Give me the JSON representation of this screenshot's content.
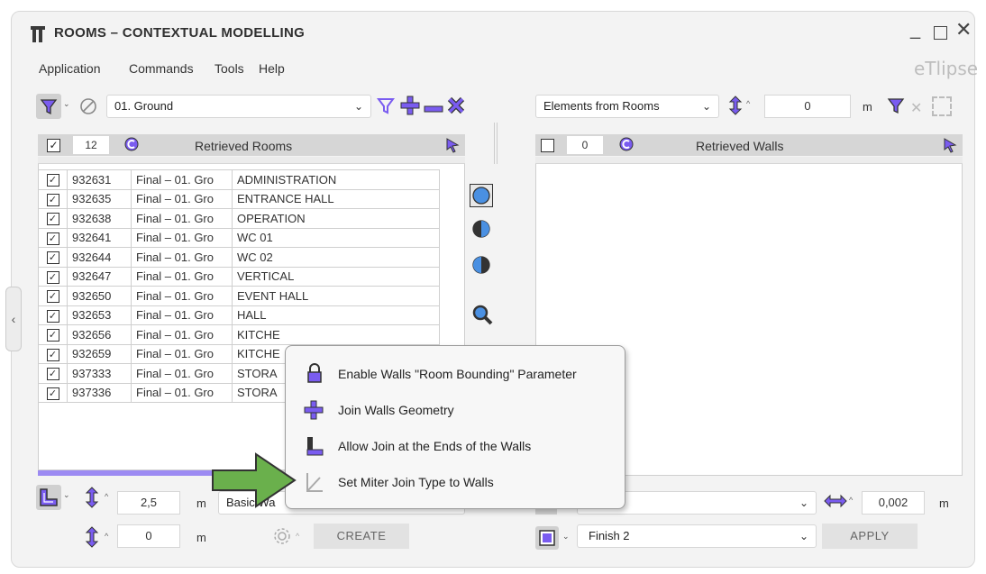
{
  "window": {
    "title": "ROOMS – CONTEXTUAL MODELLING",
    "brand": "eTlipse",
    "accent": "#7a5cf0",
    "controls": [
      "minimize-icon",
      "maximize-icon",
      "close-icon"
    ]
  },
  "menu": [
    "Application",
    "Commands",
    "Tools",
    "Help"
  ],
  "left": {
    "level_select": "01. Ground",
    "count": "12",
    "header": "Retrieved Rooms",
    "rows": [
      {
        "id": "932631",
        "phase": "Final – 01. Gro",
        "name": "ADMINISTRATION"
      },
      {
        "id": "932635",
        "phase": "Final – 01. Gro",
        "name": "ENTRANCE HALL"
      },
      {
        "id": "932638",
        "phase": "Final – 01. Gro",
        "name": "OPERATION"
      },
      {
        "id": "932641",
        "phase": "Final – 01. Gro",
        "name": "WC 01"
      },
      {
        "id": "932644",
        "phase": "Final – 01. Gro",
        "name": "WC 02"
      },
      {
        "id": "932647",
        "phase": "Final – 01. Gro",
        "name": "VERTICAL"
      },
      {
        "id": "932650",
        "phase": "Final – 01. Gro",
        "name": "EVENT HALL"
      },
      {
        "id": "932653",
        "phase": "Final – 01. Gro",
        "name": "HALL"
      },
      {
        "id": "932656",
        "phase": "Final – 01. Gro",
        "name": "KITCHE"
      },
      {
        "id": "932659",
        "phase": "Final – 01. Gro",
        "name": "KITCHE"
      },
      {
        "id": "937333",
        "phase": "Final – 01. Gro",
        "name": "STORA"
      },
      {
        "id": "937336",
        "phase": "Final – 01. Gro",
        "name": "STORA"
      }
    ],
    "height_value": "2,5",
    "height_unit": "m",
    "offset_value": "0",
    "offset_unit": "m",
    "wall_type": "Basic Wa",
    "create_label": "CREATE"
  },
  "right": {
    "source_select": "Elements from Rooms",
    "offset_value": "0",
    "offset_unit": "m",
    "count": "0",
    "header": "Retrieved Walls",
    "tolerance_value": "0,002",
    "tolerance_unit": "m",
    "finish_select": "Finish 2",
    "apply_label": "APPLY"
  },
  "context_menu": {
    "items": [
      {
        "label": "Enable Walls \"Room Bounding\" Parameter",
        "icon": "lock-icon"
      },
      {
        "label": "Join Walls Geometry",
        "icon": "plus-icon"
      },
      {
        "label": "Allow Join at the Ends of the Walls",
        "icon": "corner-join-icon"
      },
      {
        "label": "Set Miter Join Type to Walls",
        "icon": "miter-icon"
      }
    ]
  },
  "annotation": {
    "arrow_color": "#6ab04c"
  }
}
